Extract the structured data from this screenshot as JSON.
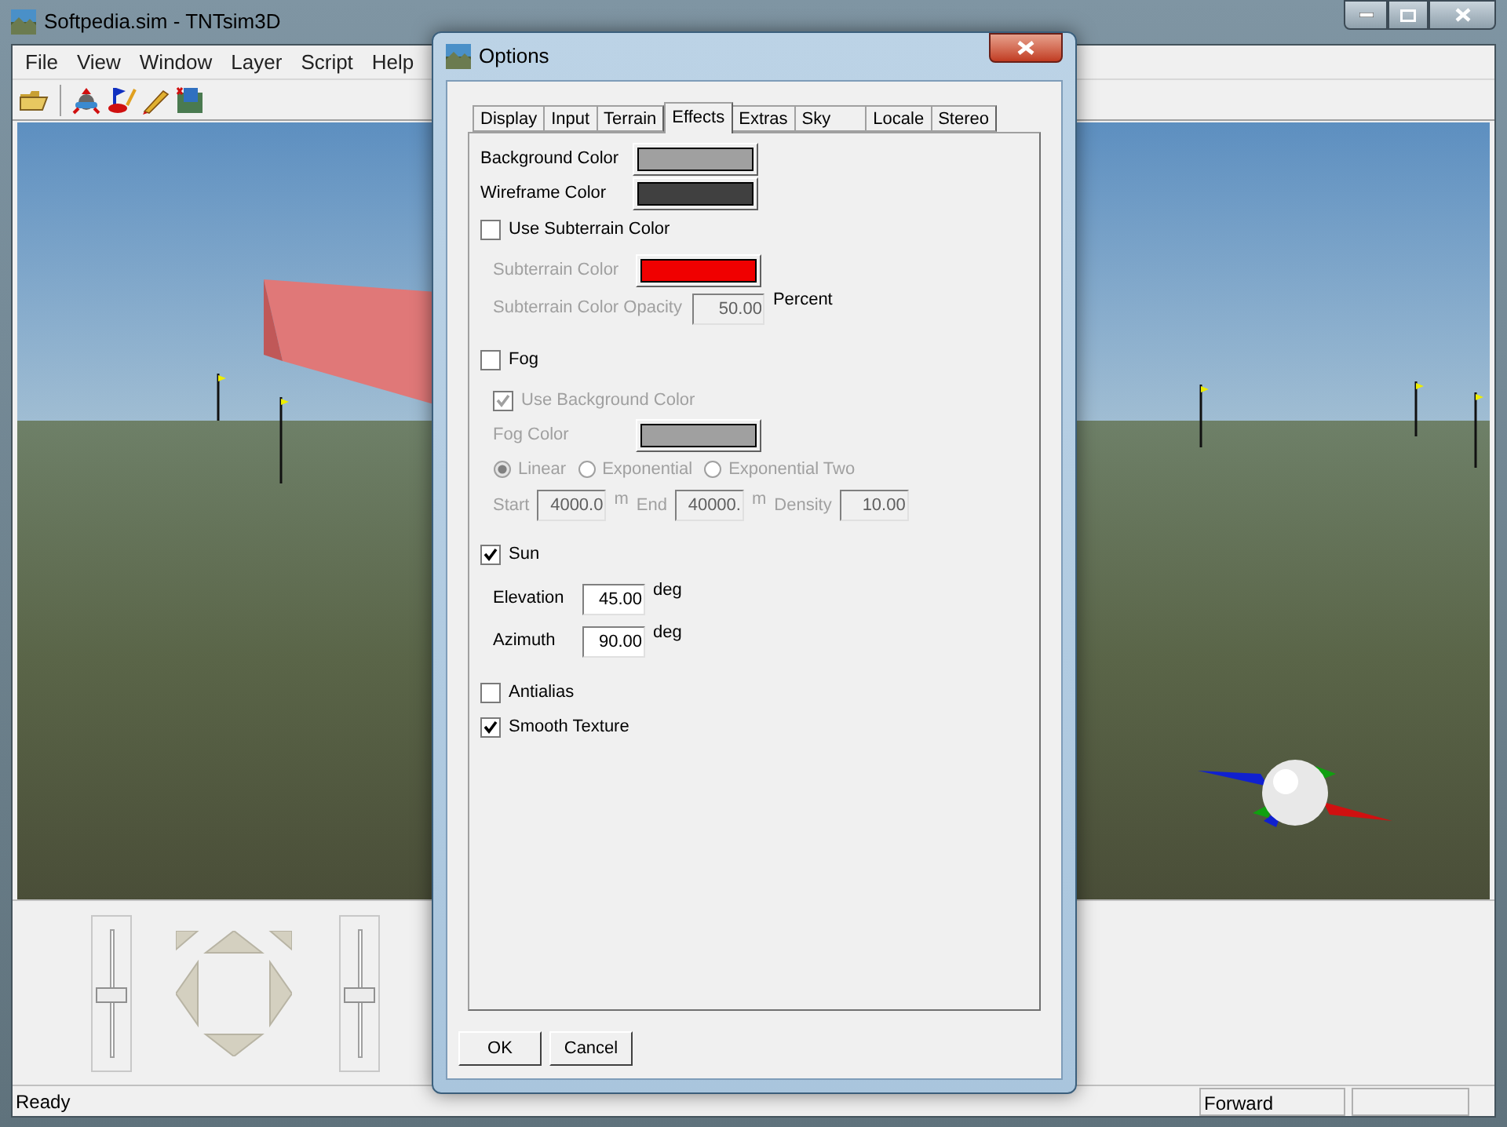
{
  "window": {
    "title": "Softpedia.sim - TNTsim3D"
  },
  "menu": [
    {
      "label": "File"
    },
    {
      "label": "View"
    },
    {
      "label": "Window"
    },
    {
      "label": "Layer"
    },
    {
      "label": "Script"
    },
    {
      "label": "Help"
    }
  ],
  "sliders": [
    {
      "level": 0.5
    },
    {
      "level": 0.5
    }
  ],
  "status_bar": {
    "text": "Ready",
    "panels": [
      "Forward"
    ]
  },
  "dialog": {
    "title": "Options",
    "tabs": [
      {
        "label": "Display",
        "selected": false
      },
      {
        "label": "Input",
        "selected": false
      },
      {
        "label": "Terrain",
        "selected": false
      },
      {
        "label": "Effects",
        "selected": true
      },
      {
        "label": "Extras",
        "selected": false
      },
      {
        "label": "Sky",
        "selected": false
      },
      {
        "label": "Locale",
        "selected": false
      },
      {
        "label": "Stereo",
        "selected": false
      }
    ],
    "rows": [
      {
        "kind": "color",
        "label": "Background Color",
        "color": "#a0a0a0",
        "disabled": false
      },
      {
        "kind": "color",
        "label": "Wireframe Color",
        "color": "#404040",
        "disabled": false
      },
      {
        "kind": "checkbox",
        "label": "Use Subterrain Color",
        "checked": false,
        "disabled": false,
        "children": [
          {
            "kind": "color",
            "label": "Subterrain Color",
            "color": "#f00000",
            "disabled": true
          },
          {
            "kind": "field",
            "label": "Subterrain Color Opacity",
            "value": "50.00",
            "unit": "Percent",
            "disabled": true
          }
        ]
      },
      {
        "kind": "checkbox",
        "label": "Fog",
        "checked": false,
        "disabled": false,
        "children": [
          {
            "kind": "checkbox",
            "label": "Use Background Color",
            "checked": true,
            "disabled": true
          },
          {
            "kind": "color",
            "label": "Fog Color",
            "color": "#a0a0a0",
            "disabled": true
          },
          {
            "kind": "radios",
            "disabled": true,
            "options": [
              {
                "label": "Linear",
                "selected": true
              },
              {
                "label": "Exponential",
                "selected": false
              },
              {
                "label": "Exponential Two",
                "selected": false
              }
            ]
          },
          {
            "kind": "fields",
            "disabled": true,
            "fields": [
              {
                "label": "Start",
                "value": "4000.0",
                "unit": "m"
              },
              {
                "label": "End",
                "value": "40000.",
                "unit": "m"
              },
              {
                "label": "Density",
                "value": "10.00"
              }
            ]
          }
        ]
      },
      {
        "kind": "checkbox",
        "label": "Sun",
        "checked": true,
        "disabled": false,
        "children": [
          {
            "kind": "field",
            "label": "Elevation",
            "value": "45.00",
            "unit": "deg",
            "disabled": false
          },
          {
            "kind": "field",
            "label": "Azimuth",
            "value": "90.00",
            "unit": "deg",
            "disabled": false
          }
        ]
      },
      {
        "kind": "checkbox",
        "label": "Antialias",
        "checked": false,
        "disabled": false
      },
      {
        "kind": "checkbox",
        "label": "Smooth Texture",
        "checked": true,
        "disabled": false
      }
    ],
    "buttons": [
      {
        "label": "OK"
      },
      {
        "label": "Cancel"
      }
    ]
  }
}
